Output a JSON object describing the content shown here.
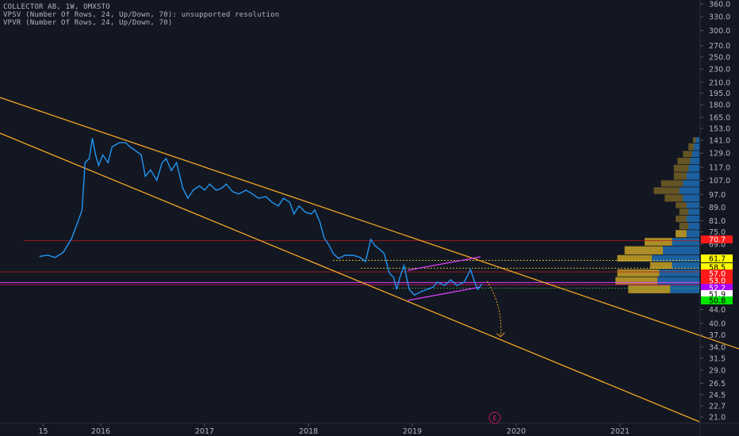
{
  "legend": {
    "title": "COLLECTOR AB, 1W, OMXSTO",
    "vpsv": "VPSV (Number Of Rows, 24, Up/Down, 70): unsupported resolution",
    "vpvr": "VPVR (Number Of Rows, 24, Up/Down, 70)"
  },
  "earnings_badge": "E",
  "colors": {
    "background": "#131722",
    "price_line": "#2196f3",
    "trend": "#f5a623",
    "pattern": "#e040fb",
    "vol_up": "#1e6fb5",
    "vol_down": "#c9a227"
  },
  "chart_data": {
    "type": "line",
    "title": "COLLECTOR AB, 1W, OMXSTO",
    "y_scale": "log",
    "ylim": [
      20.5,
      375
    ],
    "xlim": [
      2015.5,
      2021.75
    ],
    "y_ticks": [
      "360.0",
      "330.0",
      "300.0",
      "270.0",
      "250.0",
      "230.0",
      "210.0",
      "195.0",
      "180.0",
      "165.0",
      "153.0",
      "141.0",
      "129.0",
      "117.0",
      "107.0",
      "97.0",
      "89.0",
      "81.0",
      "75.0",
      "69.0",
      "44.0",
      "40.0",
      "37.0",
      "34.0",
      "31.5",
      "29.0",
      "26.5",
      "24.5",
      "22.7",
      "21.0"
    ],
    "x_ticks": [
      {
        "label": "15",
        "x": 2015.5
      },
      {
        "label": "2016",
        "x": 2016
      },
      {
        "label": "2017",
        "x": 2017
      },
      {
        "label": "2018",
        "x": 2018
      },
      {
        "label": "2019",
        "x": 2019
      },
      {
        "label": "2020",
        "x": 2020
      },
      {
        "label": "2021",
        "x": 2021
      }
    ],
    "series": [
      {
        "name": "Close",
        "points": [
          [
            2015.41,
            63.4
          ],
          [
            2015.49,
            64.0
          ],
          [
            2015.56,
            62.9
          ],
          [
            2015.64,
            65.2
          ],
          [
            2015.72,
            71.7
          ],
          [
            2015.78,
            80.4
          ],
          [
            2015.82,
            87.1
          ],
          [
            2015.85,
            120.9
          ],
          [
            2015.89,
            124.3
          ],
          [
            2015.92,
            143.0
          ],
          [
            2015.95,
            127.5
          ],
          [
            2015.98,
            118.6
          ],
          [
            2016.02,
            127.5
          ],
          [
            2016.07,
            120.9
          ],
          [
            2016.11,
            134.8
          ],
          [
            2016.18,
            138.7
          ],
          [
            2016.24,
            138.7
          ],
          [
            2016.28,
            134.8
          ],
          [
            2016.34,
            131.0
          ],
          [
            2016.39,
            127.5
          ],
          [
            2016.43,
            110.0
          ],
          [
            2016.48,
            115.0
          ],
          [
            2016.54,
            107.0
          ],
          [
            2016.59,
            120.5
          ],
          [
            2016.63,
            124.3
          ],
          [
            2016.68,
            114.5
          ],
          [
            2016.73,
            120.9
          ],
          [
            2016.79,
            101.5
          ],
          [
            2016.84,
            94.6
          ],
          [
            2016.89,
            100.0
          ],
          [
            2016.95,
            103.0
          ],
          [
            2017.0,
            100.0
          ],
          [
            2017.05,
            104.3
          ],
          [
            2017.11,
            100.0
          ],
          [
            2017.16,
            101.2
          ],
          [
            2017.21,
            104.3
          ],
          [
            2017.27,
            99.0
          ],
          [
            2017.33,
            97.4
          ],
          [
            2017.4,
            100.0
          ],
          [
            2017.46,
            97.4
          ],
          [
            2017.52,
            94.6
          ],
          [
            2017.59,
            95.7
          ],
          [
            2017.65,
            92.0
          ],
          [
            2017.71,
            89.7
          ],
          [
            2017.76,
            94.6
          ],
          [
            2017.82,
            92.0
          ],
          [
            2017.86,
            84.9
          ],
          [
            2017.91,
            89.7
          ],
          [
            2017.97,
            85.9
          ],
          [
            2018.03,
            84.9
          ],
          [
            2018.06,
            87.3
          ],
          [
            2018.11,
            80.4
          ],
          [
            2018.15,
            72.1
          ],
          [
            2018.2,
            68.3
          ],
          [
            2018.24,
            64.6
          ],
          [
            2018.29,
            62.5
          ],
          [
            2018.35,
            63.9
          ],
          [
            2018.43,
            63.9
          ],
          [
            2018.5,
            62.9
          ],
          [
            2018.55,
            61.2
          ],
          [
            2018.6,
            71.3
          ],
          [
            2018.64,
            68.3
          ],
          [
            2018.69,
            66.4
          ],
          [
            2018.73,
            64.6
          ],
          [
            2018.78,
            56.4
          ],
          [
            2018.82,
            54.9
          ],
          [
            2018.85,
            50.5
          ],
          [
            2018.88,
            54.9
          ],
          [
            2018.92,
            59.5
          ],
          [
            2018.97,
            50.5
          ],
          [
            2019.02,
            48.6
          ],
          [
            2019.08,
            49.7
          ],
          [
            2019.14,
            50.5
          ],
          [
            2019.2,
            51.3
          ],
          [
            2019.24,
            53.2
          ],
          [
            2019.31,
            51.9
          ],
          [
            2019.37,
            54.0
          ],
          [
            2019.43,
            51.9
          ],
          [
            2019.5,
            53.2
          ],
          [
            2019.56,
            57.9
          ],
          [
            2019.6,
            53.2
          ],
          [
            2019.63,
            50.5
          ],
          [
            2019.67,
            52.5
          ]
        ]
      }
    ],
    "trendlines": [
      "upper channel",
      "lower channel",
      "rising wedge"
    ],
    "horizontal_levels": [
      70.7,
      61.7,
      58.5,
      57.0,
      53.0,
      52.2,
      51.9
    ],
    "projection": {
      "from": [
        2019.72,
        53.5
      ],
      "to": [
        2019.85,
        36.5
      ]
    },
    "price_badges": [
      {
        "value": "70.7",
        "bg": "#ff1a1a",
        "fg": "#ffffff"
      },
      {
        "value": "61.7",
        "bg": "#ffff00",
        "fg": "#000000"
      },
      {
        "value": "58.5",
        "bg": "#ffff00",
        "fg": "#000000"
      },
      {
        "value": "57.0",
        "bg": "#ff1a1a",
        "fg": "#ffffff"
      },
      {
        "value": "53.0",
        "bg": "#ff1a1a",
        "fg": "#ffffff"
      },
      {
        "value": "52.2",
        "bg": "#aa00ff",
        "fg": "#ffffff"
      },
      {
        "value": "51.9",
        "bg": "#ffffff",
        "fg": "#000000"
      },
      {
        "value": "50.8",
        "bg": "#00e600",
        "fg": "#000000"
      }
    ],
    "volume_profile": {
      "rows": [
        {
          "lo": 138,
          "hi": 144,
          "up": 4,
          "down": 3
        },
        {
          "lo": 131,
          "hi": 138,
          "up": 6,
          "down": 6
        },
        {
          "lo": 125,
          "hi": 131,
          "up": 8,
          "down": 10
        },
        {
          "lo": 119,
          "hi": 125,
          "up": 10,
          "down": 14
        },
        {
          "lo": 113,
          "hi": 119,
          "up": 12,
          "down": 16
        },
        {
          "lo": 107,
          "hi": 113,
          "up": 14,
          "down": 14
        },
        {
          "lo": 102,
          "hi": 107,
          "up": 18,
          "down": 24
        },
        {
          "lo": 97,
          "hi": 102,
          "up": 22,
          "down": 28
        },
        {
          "lo": 92,
          "hi": 97,
          "up": 18,
          "down": 20
        },
        {
          "lo": 88,
          "hi": 92,
          "up": 14,
          "down": 12
        },
        {
          "lo": 84,
          "hi": 88,
          "up": 12,
          "down": 10
        },
        {
          "lo": 80,
          "hi": 84,
          "up": 14,
          "down": 12
        },
        {
          "lo": 76,
          "hi": 80,
          "up": 12,
          "down": 10
        },
        {
          "lo": 72,
          "hi": 76,
          "up": 14,
          "down": 12
        },
        {
          "lo": 68,
          "hi": 72,
          "up": 30,
          "down": 30
        },
        {
          "lo": 64,
          "hi": 68,
          "up": 40,
          "down": 42
        },
        {
          "lo": 61,
          "hi": 64,
          "up": 52,
          "down": 38
        },
        {
          "lo": 58,
          "hi": 61,
          "up": 30,
          "down": 24
        },
        {
          "lo": 55,
          "hi": 58,
          "up": 44,
          "down": 46
        },
        {
          "lo": 52,
          "hi": 55,
          "up": 46,
          "down": 46
        },
        {
          "lo": 49,
          "hi": 52,
          "up": 32,
          "down": 46
        }
      ]
    }
  }
}
